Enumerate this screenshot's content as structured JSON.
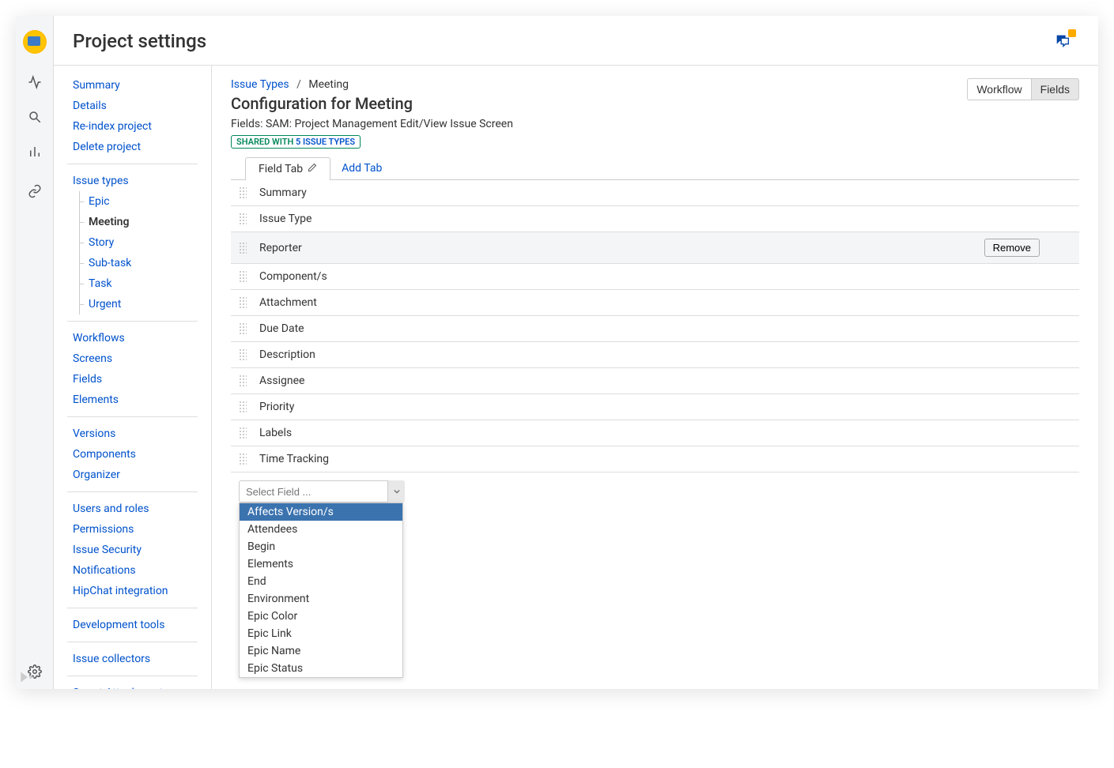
{
  "pageTitle": "Project settings",
  "breadcrumb": {
    "parent": "Issue Types",
    "current": "Meeting"
  },
  "configTitle": "Configuration for Meeting",
  "fieldsDesc": "Fields: SAM: Project Management Edit/View Issue Screen",
  "sharedBadge": {
    "prefix": "SHARED WITH ",
    "link": "5 ISSUE TYPES"
  },
  "headerButtons": {
    "workflow": "Workflow",
    "fields": "Fields"
  },
  "tabs": {
    "fieldTab": "Field Tab",
    "addTab": "Add Tab"
  },
  "sidebar": {
    "top": [
      "Summary",
      "Details",
      "Re-index project",
      "Delete project"
    ],
    "issueTypes": {
      "label": "Issue types",
      "items": [
        "Epic",
        "Meeting",
        "Story",
        "Sub-task",
        "Task",
        "Urgent"
      ],
      "active": "Meeting"
    },
    "mid1": [
      "Workflows",
      "Screens",
      "Fields",
      "Elements"
    ],
    "mid2": [
      "Versions",
      "Components",
      "Organizer"
    ],
    "mid3": [
      "Users and roles",
      "Permissions",
      "Issue Security",
      "Notifications",
      "HipChat integration"
    ],
    "mid4": [
      "Development tools"
    ],
    "mid5": [
      "Issue collectors"
    ],
    "mid6": [
      "Smart Attachments"
    ]
  },
  "fieldRows": [
    "Summary",
    "Issue Type",
    "Reporter",
    "Component/s",
    "Attachment",
    "Due Date",
    "Description",
    "Assignee",
    "Priority",
    "Labels",
    "Time Tracking"
  ],
  "highlightedRow": "Reporter",
  "removeLabel": "Remove",
  "selectPlaceholder": "Select Field ...",
  "dropdownOptions": [
    "Affects Version/s",
    "Attendees",
    "Begin",
    "Elements",
    "End",
    "Environment",
    "Epic Color",
    "Epic Link",
    "Epic Name",
    "Epic Status"
  ],
  "dropdownSelected": "Affects Version/s"
}
